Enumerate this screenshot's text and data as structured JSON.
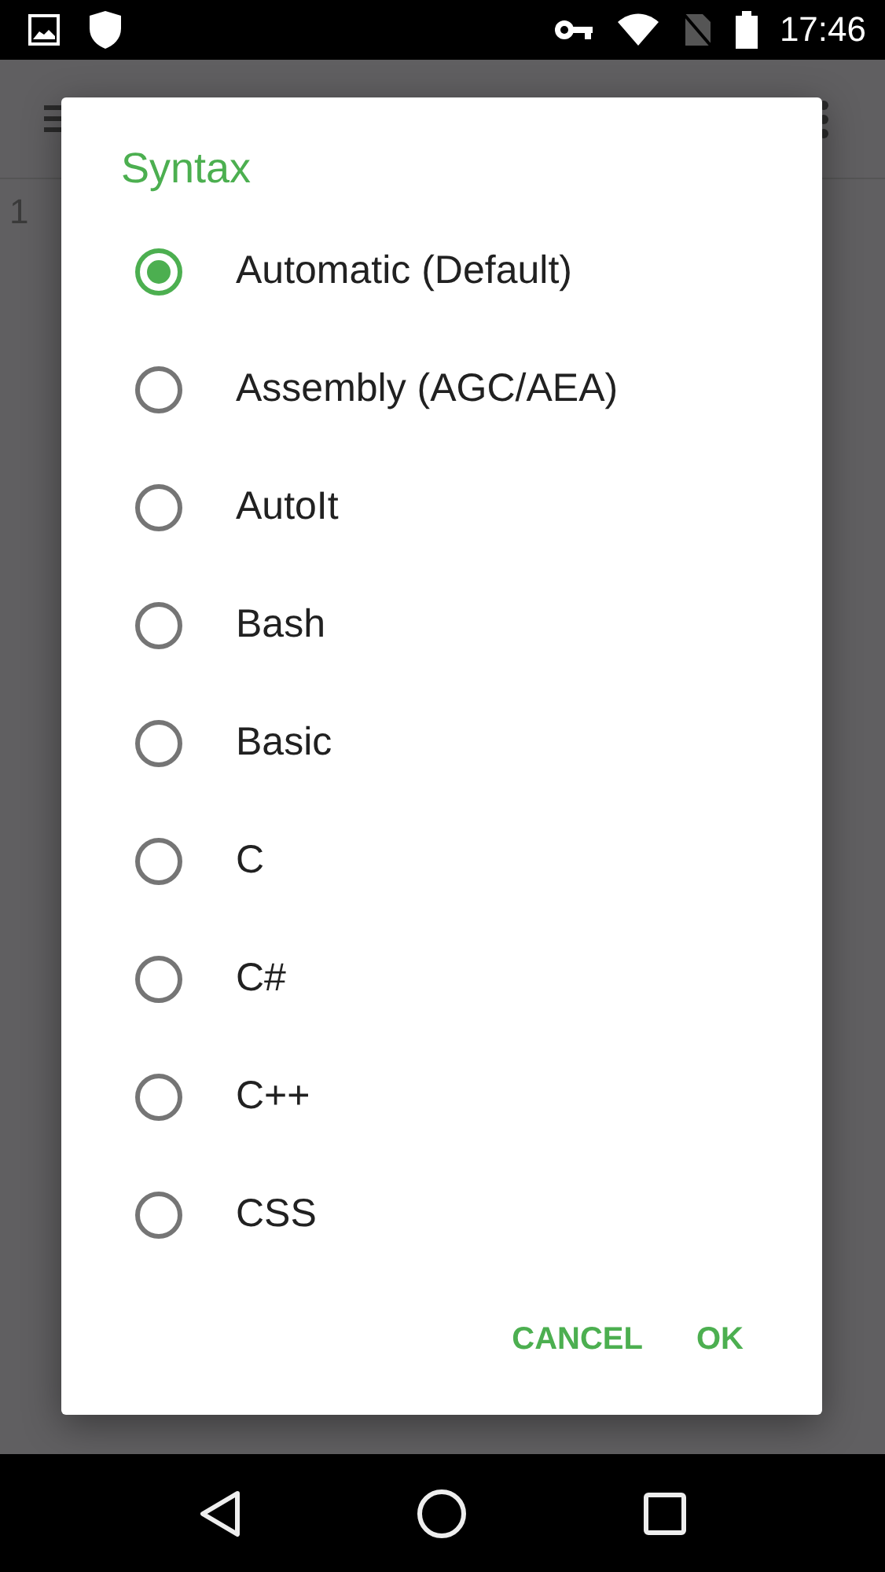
{
  "status_bar": {
    "time": "17:46"
  },
  "editor": {
    "line_number": "1"
  },
  "dialog": {
    "title": "Syntax",
    "options": [
      {
        "label": "Automatic (Default)",
        "selected": true
      },
      {
        "label": "Assembly (AGC/AEA)",
        "selected": false
      },
      {
        "label": "AutoIt",
        "selected": false
      },
      {
        "label": "Bash",
        "selected": false
      },
      {
        "label": "Basic",
        "selected": false
      },
      {
        "label": "C",
        "selected": false
      },
      {
        "label": "C#",
        "selected": false
      },
      {
        "label": "C++",
        "selected": false
      },
      {
        "label": "CSS",
        "selected": false
      }
    ],
    "buttons": [
      {
        "label": "CANCEL"
      },
      {
        "label": "OK"
      }
    ]
  }
}
